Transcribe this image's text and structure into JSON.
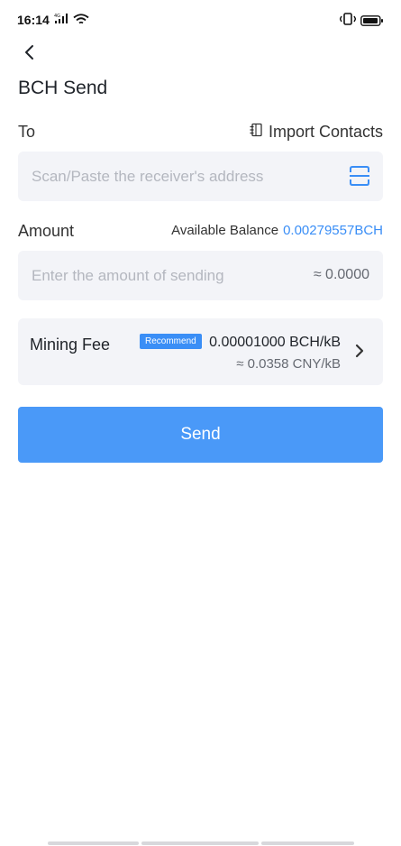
{
  "status_bar": {
    "time": "16:14",
    "network": "4G"
  },
  "header": {
    "back_icon": "chevron-left-icon",
    "title": "BCH Send"
  },
  "to_section": {
    "label": "To",
    "import_contacts_label": "Import Contacts",
    "import_contacts_icon": "contacts-book-icon",
    "address_placeholder": "Scan/Paste the receiver's address",
    "address_value": "",
    "scan_icon": "scan-icon"
  },
  "amount_section": {
    "label": "Amount",
    "available_balance_label": "Available Balance",
    "available_balance_value": "0.00279557BCH",
    "amount_placeholder": "Enter the amount of sending",
    "amount_value": "",
    "fiat_estimate": "≈ 0.0000"
  },
  "mining_fee": {
    "label": "Mining Fee",
    "badge": "Recommend",
    "rate": "0.00001000 BCH/kB",
    "fiat_rate": "≈ 0.0358 CNY/kB"
  },
  "send_button_label": "Send",
  "colors": {
    "accent": "#3a8ef6",
    "button": "#4a99f8",
    "field_background": "#f3f4f8",
    "placeholder": "#b4b7bf",
    "text": "#1f2329"
  }
}
